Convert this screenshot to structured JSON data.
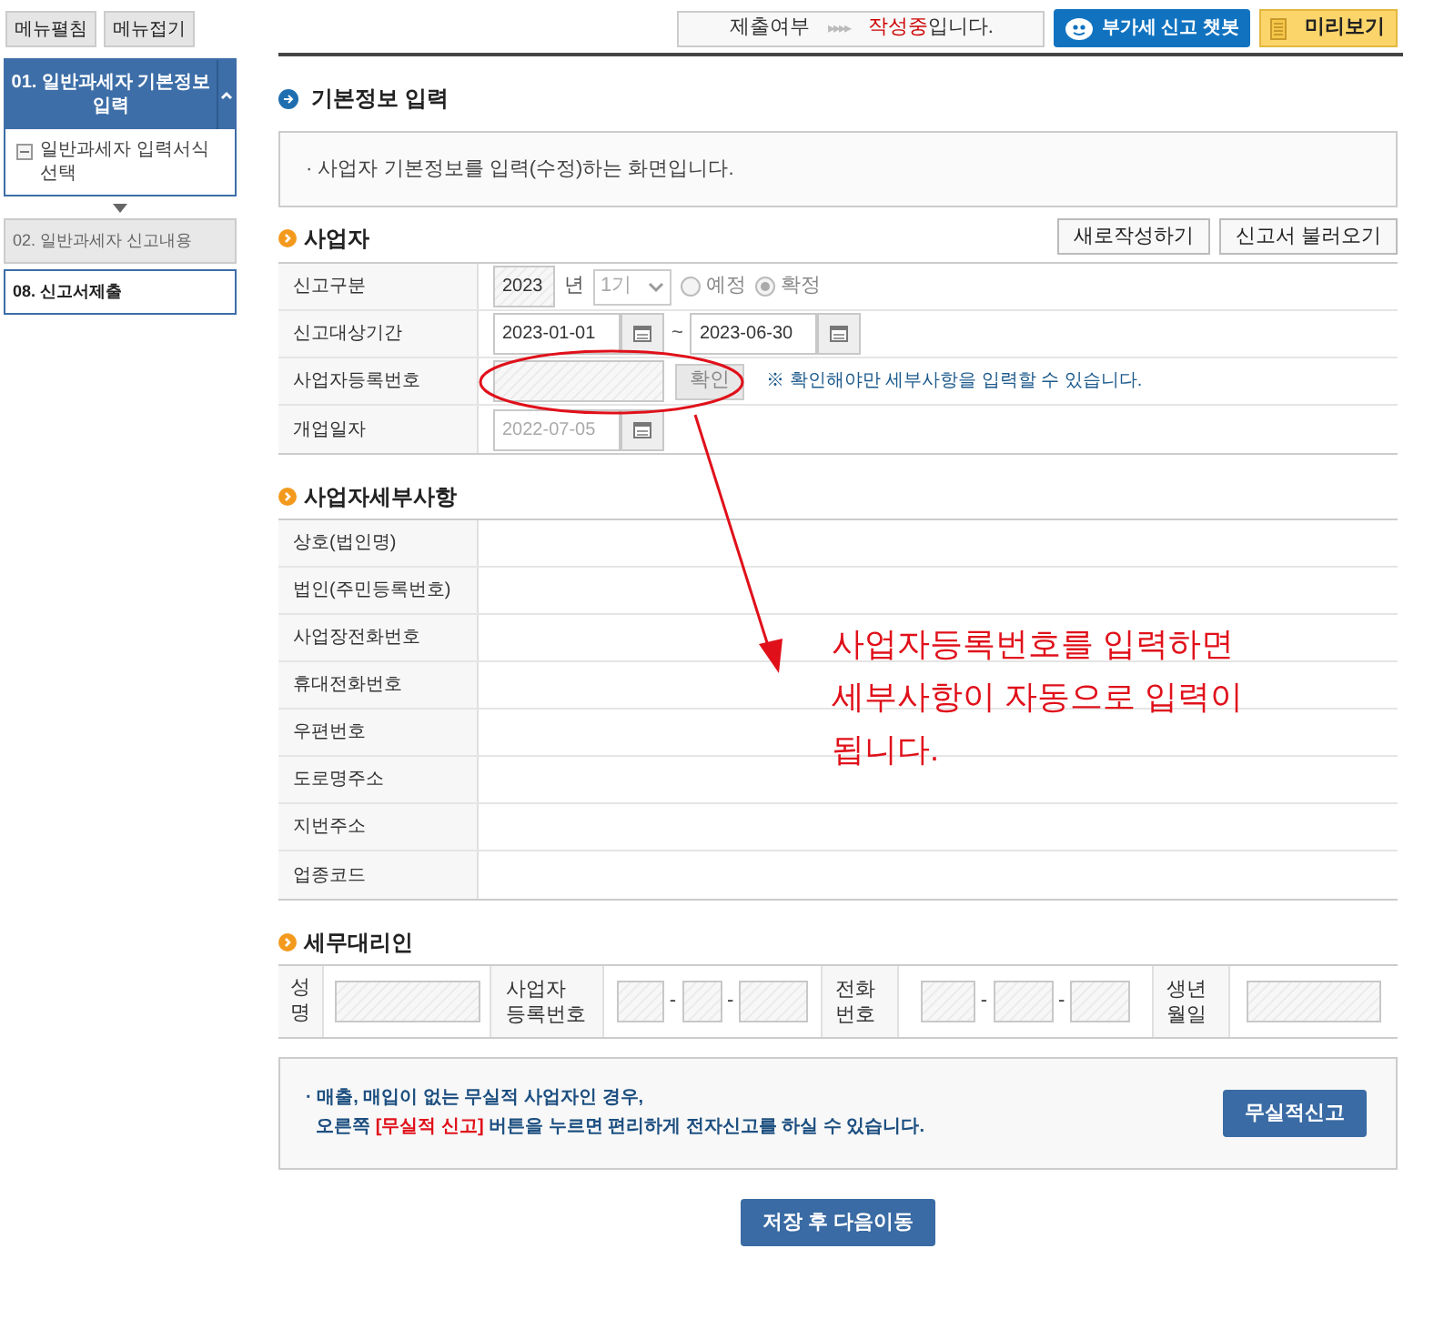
{
  "menu_buttons": [
    "메뉴펼침",
    "메뉴접기"
  ],
  "steps": [
    {
      "label": "01. 일반과세자 기본정보 입력",
      "kind": "current",
      "expanded": true,
      "children": [
        {
          "label": "일반과세자 입력서식 선택"
        }
      ]
    },
    {
      "label": "02. 일반과세자 신고내용",
      "kind": "disabled"
    },
    {
      "label": "08. 신고서제출",
      "kind": "normal"
    }
  ],
  "status": {
    "label": "제출여부",
    "arrows": "▸▸▸▸",
    "value": "작성중",
    "suffix": "입니다."
  },
  "chatbot_button": "부가세 신고 챗봇",
  "preview_button": "미리보기",
  "page_title": "기본정보 입력",
  "bullet": "·",
  "intro": "사업자 기본정보를 입력(수정)하는 화면입니다.",
  "business": {
    "title": "사업자",
    "buttons": [
      "새로작성하기",
      "신고서 불러오기"
    ],
    "report_type": {
      "label": "신고구분",
      "year": "2023",
      "year_unit": "년",
      "term": "1기",
      "options": [
        {
          "label": "예정",
          "selected": false
        },
        {
          "label": "확정",
          "selected": true
        }
      ]
    },
    "period": {
      "label": "신고대상기간",
      "from": "2023-01-01",
      "sep": "~",
      "to": "2023-06-30"
    },
    "reg_no": {
      "label": "사업자등록번호",
      "button": "확인",
      "hint": "※ 확인해야만 세부사항을 입력할 수 있습니다."
    },
    "opening_date": {
      "label": "개업일자",
      "value": "2022-07-05"
    }
  },
  "details": {
    "title": "사업자세부사항",
    "rows": [
      "상호(법인명)",
      "법인(주민등록번호)",
      "사업장전화번호",
      "휴대전화번호",
      "우편번호",
      "도로명주소",
      "지번주소",
      "업종코드"
    ]
  },
  "agent": {
    "title": "세무대리인",
    "name_label": "성명",
    "reg_label": "사업자 등록번호",
    "phone_label": "전화 번호",
    "birth_label": "생년 월일",
    "dash": "-"
  },
  "notice": {
    "lines": [
      [
        {
          "text": "매출, 매입이 없는 무실적 사업자인 경우,",
          "highlight": false
        }
      ],
      [
        {
          "text": "오른쪽 ",
          "highlight": false
        },
        {
          "text": "[무실적 신고]",
          "highlight": true
        },
        {
          "text": " 버튼을 누르면 편리하게 전자신고를 하실 수 있습니다.",
          "highlight": false
        }
      ]
    ],
    "button": "무실적신고"
  },
  "save_button": "저장 후 다음이동",
  "annotation": [
    "사업자등록번호를 입력하면",
    "세부사항이 자동으로 입력이",
    "됩니다."
  ]
}
